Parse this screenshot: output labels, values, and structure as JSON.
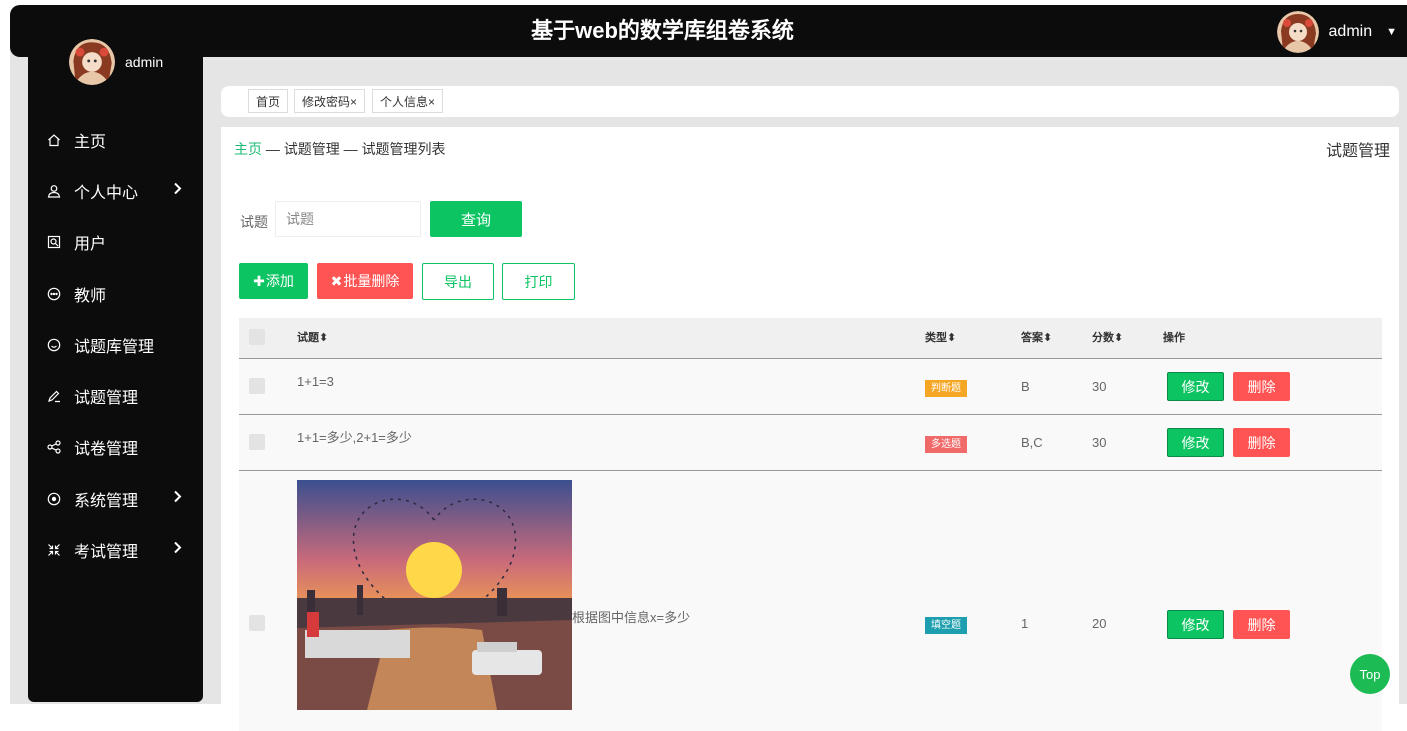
{
  "app": {
    "title": "基于web的数学库组卷系统"
  },
  "header": {
    "username": "admin"
  },
  "sidebar": {
    "username": "admin",
    "items": [
      {
        "label": "主页",
        "icon": "home-icon",
        "has_arrow": false
      },
      {
        "label": "个人中心",
        "icon": "user-icon",
        "has_arrow": true
      },
      {
        "label": "用户",
        "icon": "user-search-icon",
        "has_arrow": false
      },
      {
        "label": "教师",
        "icon": "circle-dots-icon",
        "has_arrow": false
      },
      {
        "label": "试题库管理",
        "icon": "smile-icon",
        "has_arrow": false
      },
      {
        "label": "试题管理",
        "icon": "pen-icon",
        "has_arrow": false
      },
      {
        "label": "试卷管理",
        "icon": "share-icon",
        "has_arrow": false
      },
      {
        "label": "系统管理",
        "icon": "target-icon",
        "has_arrow": true
      },
      {
        "label": "考试管理",
        "icon": "shrink-icon",
        "has_arrow": true
      }
    ]
  },
  "tabs": [
    {
      "label": "首页",
      "closable": false
    },
    {
      "label": "修改密码",
      "closable": true
    },
    {
      "label": "个人信息",
      "closable": true
    }
  ],
  "breadcrumb": {
    "home": "主页",
    "sep": "—",
    "level1": "试题管理",
    "level2": "试题管理列表"
  },
  "page_title": "试题管理",
  "search": {
    "label": "试题",
    "placeholder": "试题",
    "value": "",
    "button": "查询"
  },
  "actions": {
    "add": "添加",
    "batch_delete": "批量删除",
    "export": "导出",
    "print": "打印"
  },
  "table": {
    "columns": {
      "question": "试题",
      "type": "类型",
      "answer": "答案",
      "score": "分数",
      "ops": "操作"
    },
    "rows": [
      {
        "question": "1+1=3",
        "type": "判断题",
        "type_color": "#f5a623",
        "answer": "B",
        "score": "30",
        "edit": "修改",
        "delete": "删除"
      },
      {
        "question": "1+1=多少,2+1=多少",
        "type": "多选题",
        "type_color": "#f06a6a",
        "answer": "B,C",
        "score": "30",
        "edit": "修改",
        "delete": "删除"
      },
      {
        "question": "根据图中信息x=多少",
        "type": "填空题",
        "type_color": "#1e9fb0",
        "answer": "1",
        "score": "20",
        "edit": "修改",
        "delete": "删除",
        "has_image": true
      }
    ]
  },
  "back_to_top": "Top",
  "colors": {
    "accent": "#0cc462",
    "danger": "#ff5454",
    "sidebar_bg": "#0c0c0c"
  }
}
